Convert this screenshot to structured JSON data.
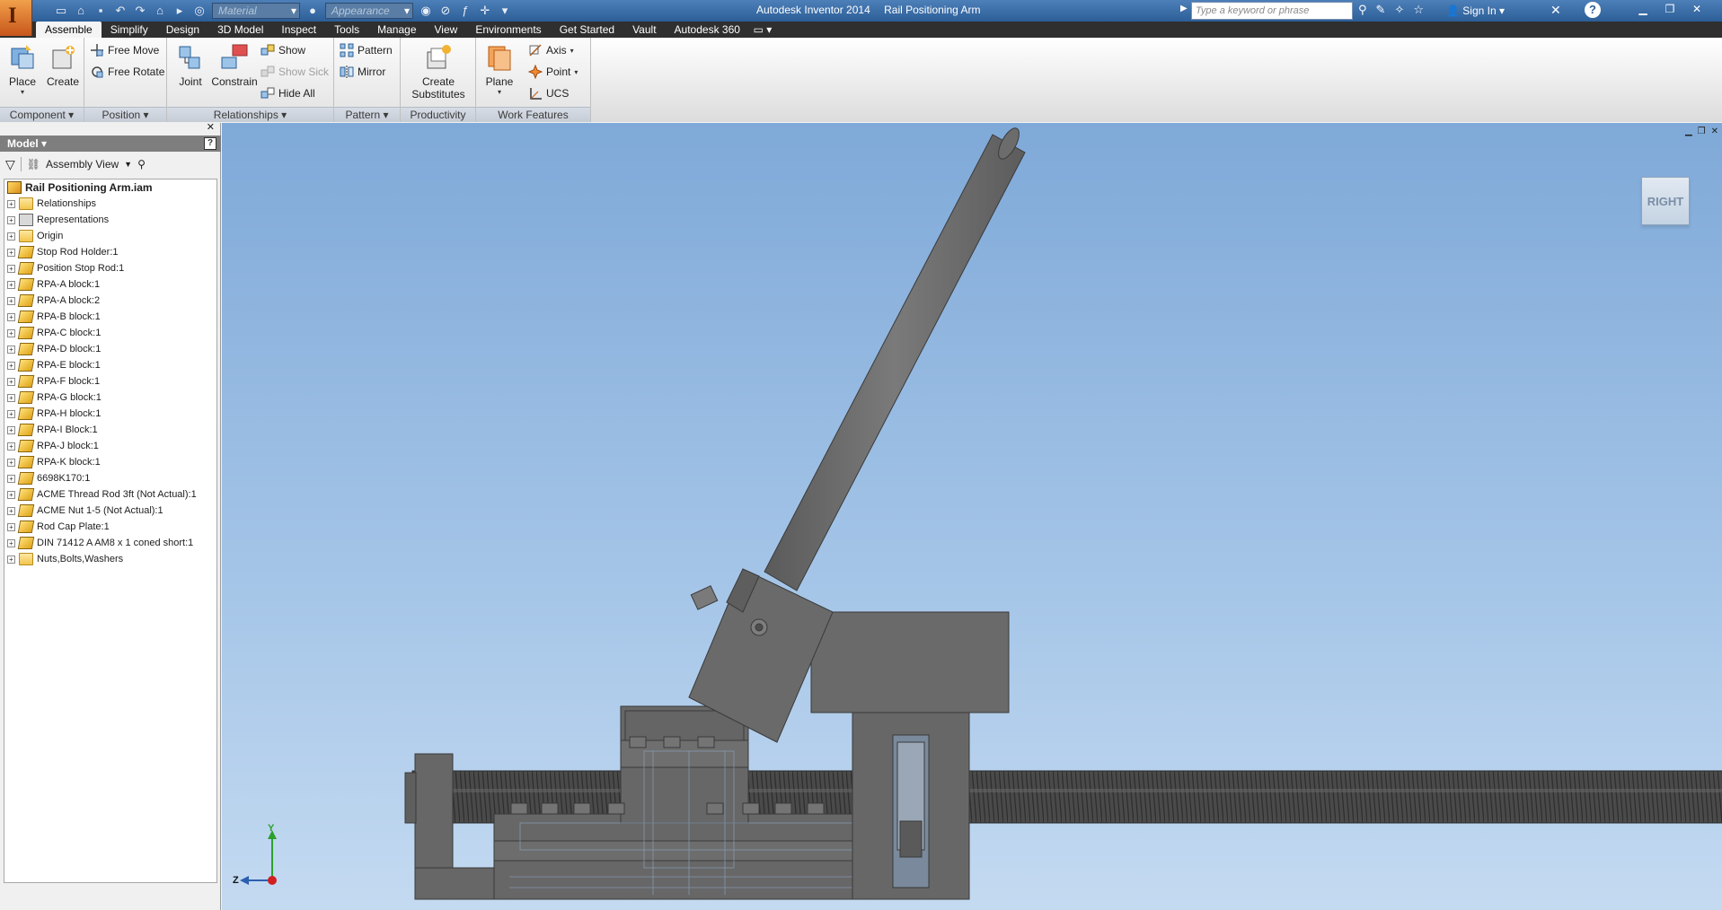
{
  "titlebar": {
    "app_name": "Autodesk Inventor 2014",
    "document": "Rail Positioning Arm",
    "material_placeholder": "Material",
    "appearance_placeholder": "Appearance",
    "search_placeholder": "Type a keyword or phrase",
    "sign_in": "Sign In",
    "logo_letter": "I"
  },
  "tabs": [
    "Assemble",
    "Simplify",
    "Design",
    "3D Model",
    "Inspect",
    "Tools",
    "Manage",
    "View",
    "Environments",
    "Get Started",
    "Vault",
    "Autodesk 360"
  ],
  "ribbon": {
    "component": {
      "label": "Component",
      "place": "Place",
      "create": "Create"
    },
    "position": {
      "label": "Position",
      "free_move": "Free Move",
      "free_rotate": "Free Rotate"
    },
    "relationships": {
      "label": "Relationships",
      "joint": "Joint",
      "constrain": "Constrain",
      "show": "Show",
      "show_sick": "Show Sick",
      "hide_all": "Hide All"
    },
    "pattern": {
      "label": "Pattern",
      "pattern": "Pattern",
      "mirror": "Mirror"
    },
    "productivity": {
      "label": "Productivity",
      "create_sub_1": "Create",
      "create_sub_2": "Substitutes"
    },
    "work_features": {
      "label": "Work Features",
      "plane": "Plane",
      "axis": "Axis",
      "point": "Point",
      "ucs": "UCS"
    }
  },
  "browser": {
    "header": "Model",
    "view_mode": "Assembly View",
    "root": "Rail Positioning Arm.iam",
    "items": [
      {
        "label": "Relationships",
        "icon": "folder-icon"
      },
      {
        "label": "Representations",
        "icon": "representations-icon"
      },
      {
        "label": "Origin",
        "icon": "folder-icon"
      },
      {
        "label": "Stop Rod Holder:1",
        "icon": "part-icon"
      },
      {
        "label": "Position Stop Rod:1",
        "icon": "part-icon"
      },
      {
        "label": "RPA-A block:1",
        "icon": "part-icon"
      },
      {
        "label": "RPA-A block:2",
        "icon": "part-icon"
      },
      {
        "label": "RPA-B block:1",
        "icon": "part-icon"
      },
      {
        "label": "RPA-C block:1",
        "icon": "part-icon"
      },
      {
        "label": "RPA-D block:1",
        "icon": "part-icon"
      },
      {
        "label": "RPA-E block:1",
        "icon": "part-icon"
      },
      {
        "label": "RPA-F block:1",
        "icon": "part-icon"
      },
      {
        "label": "RPA-G block:1",
        "icon": "part-icon"
      },
      {
        "label": "RPA-H block:1",
        "icon": "part-icon"
      },
      {
        "label": "RPA-I Block:1",
        "icon": "part-icon"
      },
      {
        "label": "RPA-J block:1",
        "icon": "part-icon"
      },
      {
        "label": "RPA-K block:1",
        "icon": "part-icon"
      },
      {
        "label": "6698K170:1",
        "icon": "part-icon"
      },
      {
        "label": "ACME Thread Rod 3ft (Not Actual):1",
        "icon": "part-icon"
      },
      {
        "label": "ACME Nut 1-5 (Not Actual):1",
        "icon": "part-icon"
      },
      {
        "label": "Rod Cap Plate:1",
        "icon": "part-icon"
      },
      {
        "label": "DIN 71412 A AM8 x 1 coned short:1",
        "icon": "part-icon"
      },
      {
        "label": "Nuts,Bolts,Washers",
        "icon": "folder-icon"
      }
    ]
  },
  "viewport": {
    "viewcube_label": "RIGHT",
    "triad_y": "Y",
    "triad_z": "Z"
  },
  "colors": {
    "titlebar": "#2c5e98",
    "tabbar": "#2f2f2f",
    "viewport_top": "#7fa9d8",
    "viewport_bottom": "#c4daf1",
    "model": "#676767"
  }
}
